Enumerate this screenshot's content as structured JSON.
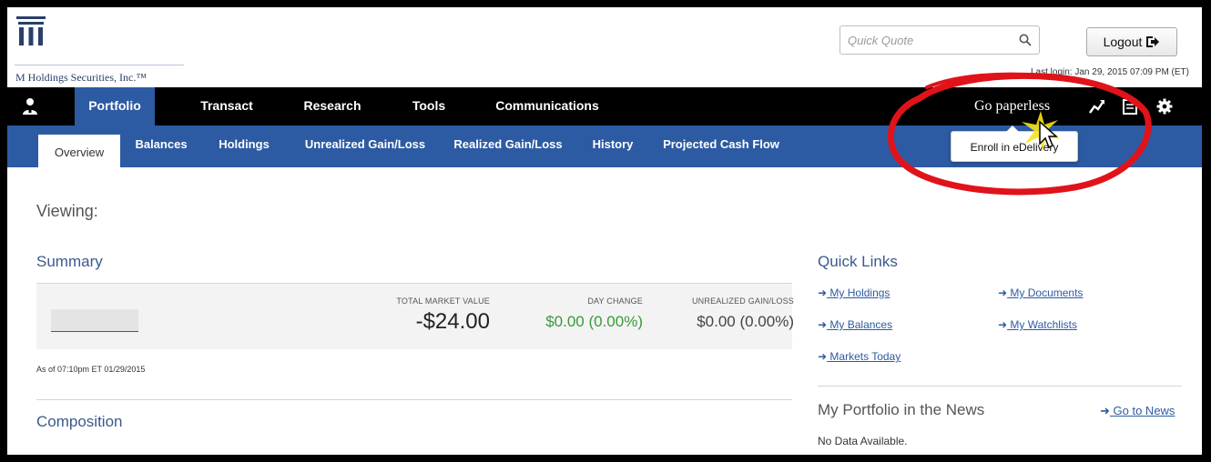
{
  "header": {
    "logo_text": "M Holdings Securities, Inc.™",
    "search_placeholder": "Quick Quote",
    "logout_label": "Logout",
    "last_login": "Last login: Jan 29, 2015 07:09 PM (ET)"
  },
  "main_nav": {
    "items": [
      {
        "label": "Portfolio"
      },
      {
        "label": "Transact"
      },
      {
        "label": "Research"
      },
      {
        "label": "Tools"
      },
      {
        "label": "Communications"
      }
    ],
    "paperless_label": "Go paperless"
  },
  "sub_nav": {
    "items": [
      {
        "label": "Overview"
      },
      {
        "label": "Balances"
      },
      {
        "label": "Holdings"
      },
      {
        "label": "Unrealized Gain/Loss"
      },
      {
        "label": "Realized Gain/Loss"
      },
      {
        "label": "History"
      },
      {
        "label": "Projected Cash Flow"
      }
    ]
  },
  "tooltip": {
    "label": "Enroll in eDelivery"
  },
  "viewing": {
    "label": "Viewing:"
  },
  "summary": {
    "title": "Summary",
    "total_market_value_label": "TOTAL MARKET VALUE",
    "total_market_value": "-$24.00",
    "day_change_label": "DAY CHANGE",
    "day_change": "$0.00 (0.00%)",
    "unrealized_label": "UNREALIZED GAIN/LOSS",
    "unrealized": "$0.00 (0.00%)",
    "as_of": "As of 07:10pm ET 01/29/2015"
  },
  "composition": {
    "title": "Composition"
  },
  "quick_links": {
    "title": "Quick Links",
    "items": [
      {
        "label": " My Holdings"
      },
      {
        "label": " My Documents"
      },
      {
        "label": " My Balances"
      },
      {
        "label": " My Watchlists"
      },
      {
        "label": " Markets Today"
      }
    ]
  },
  "news": {
    "title": "My Portfolio in the News",
    "go_label": " Go to News",
    "no_data": "No Data Available."
  },
  "colors": {
    "nav_black": "#000000",
    "accent_blue": "#2d5ba3",
    "positive_green": "#3a9a3a",
    "annotation_red": "#e0131a"
  }
}
